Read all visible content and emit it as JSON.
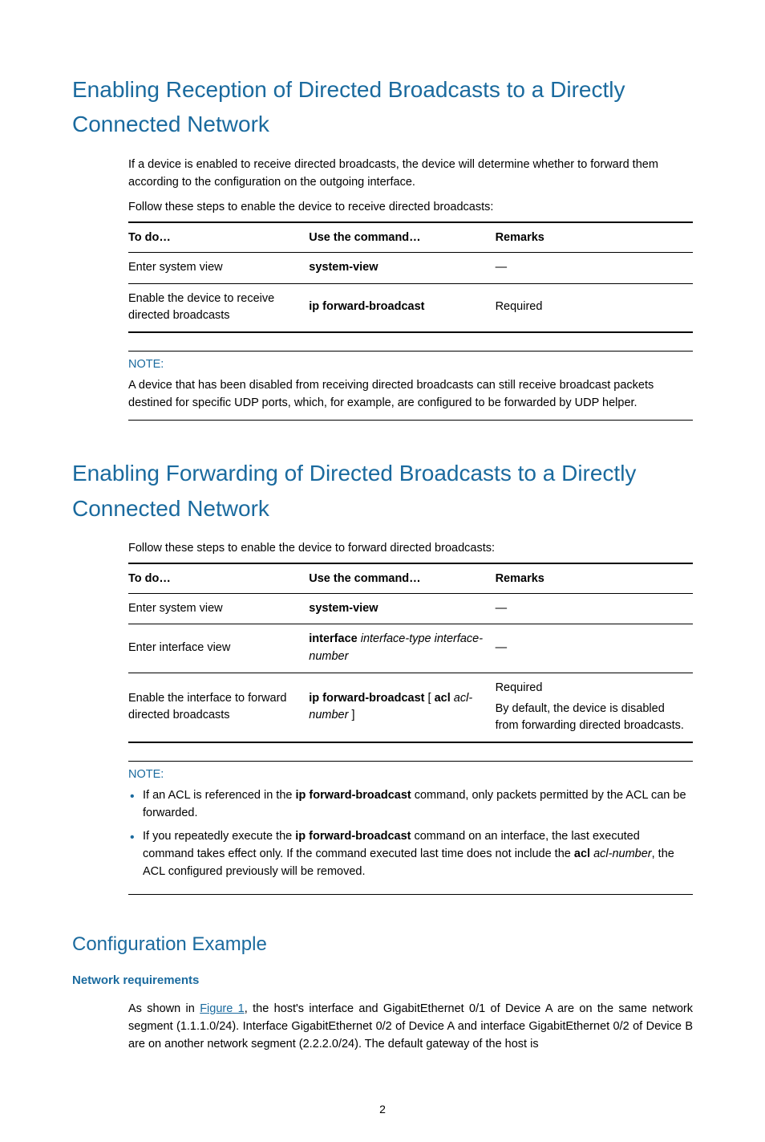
{
  "section1": {
    "title": "Enabling Reception of Directed Broadcasts to a Directly Connected Network",
    "intro": "If a device is enabled to receive directed broadcasts, the device will determine whether to forward them according to the configuration on the outgoing interface.",
    "followSteps": "Follow these steps to enable the device to receive directed broadcasts:",
    "table": {
      "headers": {
        "todo": "To do…",
        "cmd": "Use the command…",
        "remarks": "Remarks"
      },
      "rows": [
        {
          "todo": "Enter system view",
          "cmd_bold": "system-view",
          "remarks": "—"
        },
        {
          "todo": "Enable the device to receive directed broadcasts",
          "cmd_bold": "ip forward-broadcast",
          "remarks": "Required"
        }
      ]
    },
    "note": {
      "label": "NOTE:",
      "text": "A device that has been disabled from receiving directed broadcasts can still receive broadcast packets destined for specific UDP ports, which, for example, are configured to be forwarded by UDP helper."
    }
  },
  "section2": {
    "title": "Enabling Forwarding of Directed Broadcasts to a Directly Connected Network",
    "followSteps": "Follow these steps to enable the device to forward directed broadcasts:",
    "table": {
      "headers": {
        "todo": "To do…",
        "cmd": "Use the command…",
        "remarks": "Remarks"
      },
      "rows": [
        {
          "todo": "Enter system view",
          "cmd_bold": "system-view",
          "cmd_italic": "",
          "remarks": "—"
        },
        {
          "todo": "Enter interface view",
          "cmd_bold": "interface",
          "cmd_italic": " interface-type interface-number",
          "remarks": "—"
        },
        {
          "todo": "Enable the interface to forward directed broadcasts",
          "cmd_bold": "ip forward-broadcast",
          "cmd_mid1": " [ ",
          "cmd_bold2": "acl",
          "cmd_italic2": " acl-number",
          "cmd_mid2": " ]",
          "remarks_multi": {
            "p1": "Required",
            "p2": "By default, the device is disabled from forwarding directed broadcasts."
          }
        }
      ]
    },
    "note": {
      "label": "NOTE:",
      "bullets": [
        {
          "pre": "If an ACL is referenced in the ",
          "b1": "ip forward-broadcast",
          "post": " command, only packets permitted by the ACL can be forwarded."
        },
        {
          "pre": "If you repeatedly execute the ",
          "b1": "ip forward-broadcast",
          "mid": " command on an interface, the last executed command takes effect only. If the command executed last time does not include the ",
          "b2": "acl",
          "it": " acl-number",
          "post2": ", the ACL configured previously will be removed."
        }
      ]
    }
  },
  "section3": {
    "title": "Configuration Example",
    "subheading": "Network requirements",
    "para": {
      "pre": "As shown in ",
      "figlink": "Figure 1",
      "post": ", the host's interface and GigabitEthernet 0/1 of Device A are on the same network segment (1.1.1.0/24). Interface GigabitEthernet 0/2 of Device A and interface GigabitEthernet 0/2 of Device B are on another network segment (2.2.2.0/24). The default gateway of the host is"
    }
  },
  "pageNumber": "2"
}
